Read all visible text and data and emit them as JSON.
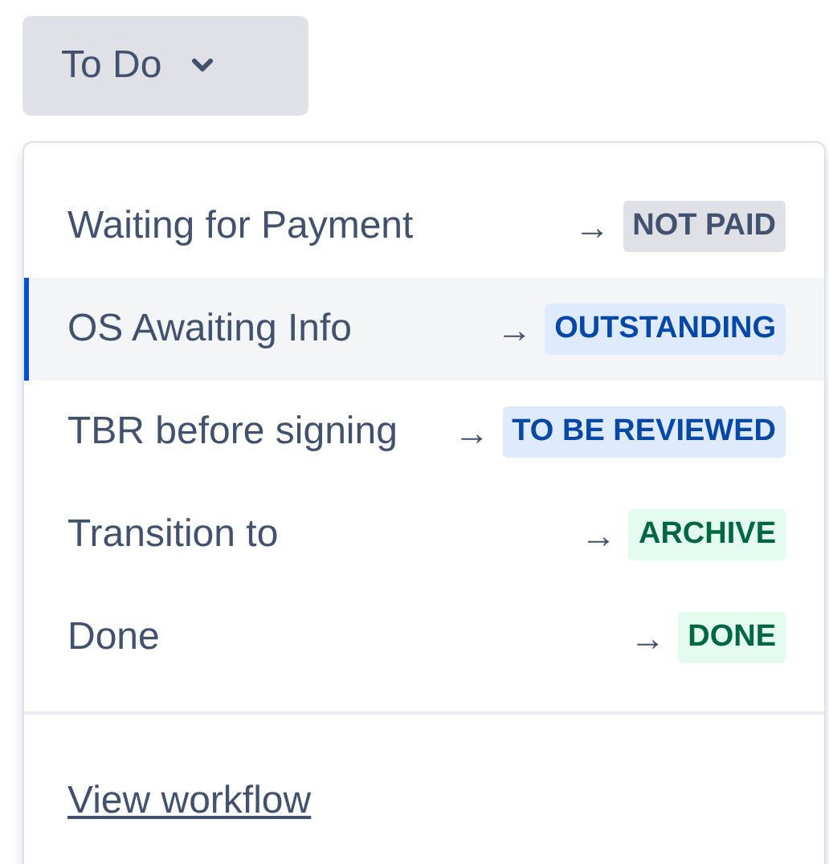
{
  "status_button": {
    "label": "To Do",
    "expanded": true
  },
  "transitions": [
    {
      "name": "Waiting for Payment",
      "arrow": "→",
      "status": "NOT PAID",
      "kind": "neutral",
      "selected": false
    },
    {
      "name": "OS Awaiting Info",
      "arrow": "→",
      "status": "OUTSTANDING",
      "kind": "info",
      "selected": true
    },
    {
      "name": "TBR before signing",
      "arrow": "→",
      "status": "TO BE REVIEWED",
      "kind": "info",
      "selected": false
    },
    {
      "name": "Transition to",
      "arrow": "→",
      "status": "ARCHIVE",
      "kind": "success",
      "selected": false
    },
    {
      "name": "Done",
      "arrow": "→",
      "status": "DONE",
      "kind": "success",
      "selected": false
    }
  ],
  "footer_link": "View workflow"
}
